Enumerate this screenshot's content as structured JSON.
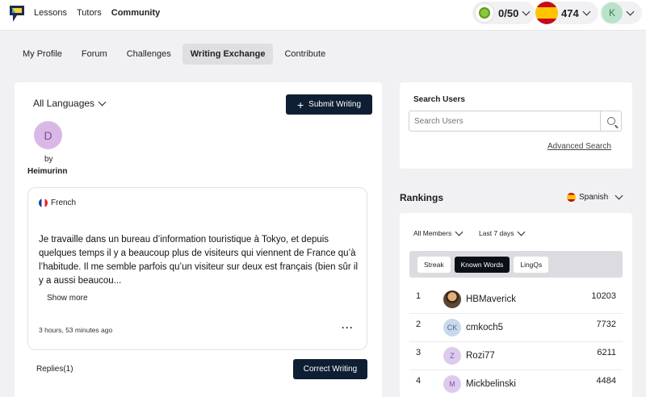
{
  "nav": {
    "links": [
      "Lessons",
      "Tutors",
      "Community"
    ],
    "active_link": "Community",
    "streak": "0/50",
    "known_words": "474",
    "user_initial": "K"
  },
  "subnav": {
    "tabs": [
      "My Profile",
      "Forum",
      "Challenges",
      "Writing Exchange",
      "Contribute"
    ],
    "active": "Writing Exchange"
  },
  "writing": {
    "language_filter": "All Languages",
    "submit_label": "Submit Writing",
    "author_initial": "D",
    "by_label": "by",
    "author_name": "Heimurinn",
    "post": {
      "language": "French",
      "text": "Je travaille dans un bureau d’information touristique à Tokyo, et depuis quelques temps il y a beaucoup plus de visiteurs qui viennent de France qu’à l’habitude. Il me semble parfois qu’un visiteur sur deux est français (bien sûr il y a aussi beaucou...",
      "show_more": "Show more",
      "time": "3 hours, 53 minutes ago",
      "more": "···"
    },
    "replies_label": "Replies(1)",
    "correct_label": "Correct Writing"
  },
  "search": {
    "title": "Search Users",
    "placeholder": "Search Users",
    "advanced": "Advanced Search"
  },
  "rankings": {
    "title": "Rankings",
    "language": "Spanish",
    "filter_members": "All Members",
    "filter_period": "Last 7 days",
    "segments": [
      "Streak",
      "Known Words",
      "LingQs"
    ],
    "active_segment": "Known Words",
    "rows": [
      {
        "rank": "1",
        "initials": "",
        "name": "HBMaverick",
        "score": "10203",
        "avatar_bg": "#5b4637",
        "avatar_fg": "#ffffff"
      },
      {
        "rank": "2",
        "initials": "CK",
        "name": "cmkoch5",
        "score": "7732",
        "avatar_bg": "#c9d8ec",
        "avatar_fg": "#4b6a93"
      },
      {
        "rank": "3",
        "initials": "Z",
        "name": "Rozi77",
        "score": "6211",
        "avatar_bg": "#dccbee",
        "avatar_fg": "#7a5aa0"
      },
      {
        "rank": "4",
        "initials": "M",
        "name": "Mickbelinski",
        "score": "4484",
        "avatar_bg": "#dccbee",
        "avatar_fg": "#7a5aa0"
      }
    ]
  },
  "colors": {
    "dark_button": "#0f1f33",
    "background": "#f1f1f3"
  }
}
